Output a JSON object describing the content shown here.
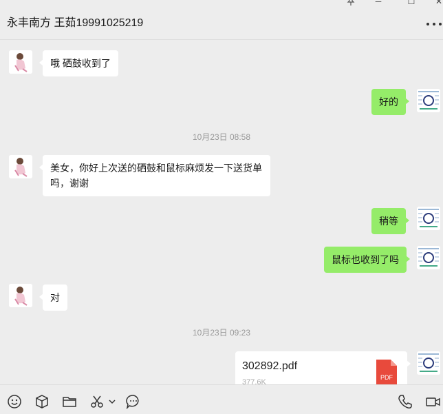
{
  "header": {
    "title": "永丰南方 王茹19991025219",
    "controls": {
      "pin": "pin-icon",
      "minimize": "─",
      "maximize": "☐",
      "close": "✕"
    }
  },
  "messages": [
    {
      "sender": "other",
      "text": "哦   硒鼓收到了"
    },
    {
      "sender": "me",
      "text": "好的"
    },
    {
      "type": "time",
      "text": "10月23日 08:58"
    },
    {
      "sender": "other",
      "text_line1": "美女，你好上次送的硒鼓和鼠标麻烦发一下送货单",
      "text_line2": "吗，谢谢"
    },
    {
      "sender": "me",
      "text": "稍等"
    },
    {
      "sender": "me",
      "text": "鼠标也收到了吗"
    },
    {
      "sender": "other",
      "text": "对"
    },
    {
      "type": "time",
      "text": "10月23日 09:23"
    },
    {
      "sender": "me",
      "type": "file",
      "file_name": "302892.pdf",
      "file_size": "377.6K",
      "file_badge": "PDF"
    }
  ],
  "toolbar": {
    "icons": [
      "emoji-icon",
      "box-icon",
      "folder-icon",
      "scissors-icon",
      "chevron-down-icon",
      "chat-history-icon",
      "phone-icon",
      "video-icon"
    ]
  },
  "colors": {
    "background": "#ededed",
    "my_bubble": "#95ec69",
    "other_bubble": "#ffffff",
    "pdf_red": "#e84a3c"
  }
}
